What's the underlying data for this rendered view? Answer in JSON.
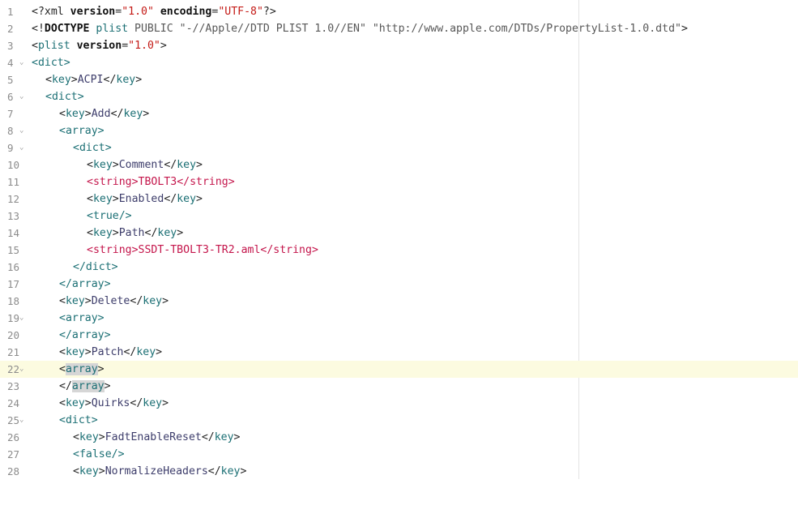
{
  "editor": {
    "gutter_numbers": [
      "1",
      "2",
      "3",
      "4",
      "5",
      "6",
      "7",
      "8",
      "9",
      "10",
      "11",
      "12",
      "13",
      "14",
      "15",
      "16",
      "17",
      "18",
      "19",
      "20",
      "21",
      "22",
      "23",
      "24",
      "25",
      "26",
      "27",
      "28"
    ],
    "fold_icon": "chevron-down-icon",
    "highlight_line": "22",
    "lines": {
      "l1": {
        "open": "<?",
        "name": "xml",
        "attr1": " version",
        "eq1": "=",
        "val1": "\"1.0\"",
        "attr2": " encoding",
        "eq2": "=",
        "val2": "\"UTF-8\"",
        "close": "?>"
      },
      "l2": {
        "open": "<!",
        "doctype": "DOCTYPE",
        "plist": " plist",
        "public": " PUBLIC ",
        "fpi": "\"-//Apple//DTD PLIST 1.0//EN\"",
        "sp": " ",
        "url": "\"http://www.apple.com/DTDs/PropertyList-1.0.dtd\"",
        "close": ">"
      },
      "l3": {
        "open": "<",
        "name": "plist",
        "attr": " version",
        "eq": "=",
        "val": "\"1.0\"",
        "close": ">"
      },
      "l4": {
        "text": "<dict>"
      },
      "l5": {
        "o": "<",
        "tag": "key",
        "c": ">",
        "v": "ACPI",
        "eo": "</",
        "etag": "key",
        "ec": ">"
      },
      "l6": {
        "text": "<dict>"
      },
      "l7": {
        "o": "<",
        "tag": "key",
        "c": ">",
        "v": "Add",
        "eo": "</",
        "etag": "key",
        "ec": ">"
      },
      "l8": {
        "text": "<array>"
      },
      "l9": {
        "text": "<dict>"
      },
      "l10": {
        "o": "<",
        "tag": "key",
        "c": ">",
        "v": "Comment",
        "eo": "</",
        "etag": "key",
        "ec": ">"
      },
      "l11": {
        "o": "<",
        "tag": "string",
        "c": ">",
        "v": "TBOLT3",
        "eo": "</",
        "etag": "string",
        "ec": ">"
      },
      "l12": {
        "o": "<",
        "tag": "key",
        "c": ">",
        "v": "Enabled",
        "eo": "</",
        "etag": "key",
        "ec": ">"
      },
      "l13": {
        "text": "<true/>"
      },
      "l14": {
        "o": "<",
        "tag": "key",
        "c": ">",
        "v": "Path",
        "eo": "</",
        "etag": "key",
        "ec": ">"
      },
      "l15": {
        "o": "<",
        "tag": "string",
        "c": ">",
        "v": "SSDT-TBOLT3-TR2.aml",
        "eo": "</",
        "etag": "string",
        "ec": ">"
      },
      "l16": {
        "text": "</dict>"
      },
      "l17": {
        "text": "</array>"
      },
      "l18": {
        "o": "<",
        "tag": "key",
        "c": ">",
        "v": "Delete",
        "eo": "</",
        "etag": "key",
        "ec": ">"
      },
      "l19": {
        "text": "<array>"
      },
      "l20": {
        "text": "</array>"
      },
      "l21": {
        "o": "<",
        "tag": "key",
        "c": ">",
        "v": "Patch",
        "eo": "</",
        "etag": "key",
        "ec": ">"
      },
      "l22": {
        "o": "<",
        "tag": "array",
        "c": ">"
      },
      "l23": {
        "o": "</",
        "tag": "array",
        "c": ">"
      },
      "l24": {
        "o": "<",
        "tag": "key",
        "c": ">",
        "v": "Quirks",
        "eo": "</",
        "etag": "key",
        "ec": ">"
      },
      "l25": {
        "text": "<dict>"
      },
      "l26": {
        "o": "<",
        "tag": "key",
        "c": ">",
        "v": "FadtEnableReset",
        "eo": "</",
        "etag": "key",
        "ec": ">"
      },
      "l27": {
        "text": "<false/>"
      },
      "l28": {
        "o": "<",
        "tag": "key",
        "c": ">",
        "v": "NormalizeHeaders",
        "eo": "</",
        "etag": "key",
        "ec": ">"
      }
    }
  }
}
